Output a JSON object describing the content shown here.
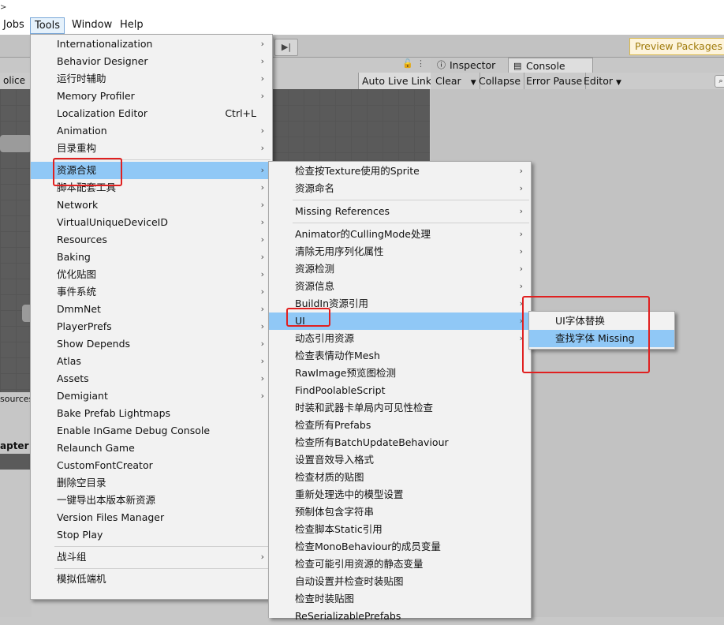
{
  "menubar": {
    "tiny": ">",
    "items": [
      "Jobs",
      "Tools",
      "Window",
      "Help"
    ]
  },
  "toolbar": {
    "step_icon": "step-forward-icon",
    "step_glyph": "▶|",
    "preview_packages": "Preview Packages in"
  },
  "scene": {
    "tab_fragment": "olice",
    "lock_icon": "lock-icon",
    "more_icon": "more-menu-icon",
    "auto_live_link": "Auto Live Link",
    "resources_fragment": "sourcesF",
    "chapter_fragment": "apter"
  },
  "console": {
    "tabs": [
      {
        "label": "Inspector",
        "icon": "info-icon"
      },
      {
        "label": "Console",
        "icon": "console-icon"
      }
    ],
    "toolbar": [
      "Clear",
      "Collapse",
      "Error Pause",
      "Editor"
    ]
  },
  "tools_menu": {
    "items": [
      {
        "label": "Internationalization",
        "arrow": true
      },
      {
        "label": "Behavior Designer",
        "arrow": true
      },
      {
        "label": "运行时辅助",
        "arrow": true
      },
      {
        "label": "Memory Profiler",
        "arrow": true
      },
      {
        "label": "Localization Editor",
        "shortcut": "Ctrl+L"
      },
      {
        "label": "Animation",
        "arrow": true
      },
      {
        "label": "目录重构",
        "arrow": true
      },
      {
        "label": "资源合规",
        "arrow": true,
        "highlighted": true
      },
      {
        "label": "脚本配套工具",
        "arrow": true
      },
      {
        "label": "Network",
        "arrow": true
      },
      {
        "label": "VirtualUniqueDeviceID",
        "arrow": true
      },
      {
        "label": "Resources",
        "arrow": true
      },
      {
        "label": "Baking",
        "arrow": true
      },
      {
        "label": "优化贴图",
        "arrow": true
      },
      {
        "label": "事件系统",
        "arrow": true
      },
      {
        "label": "DmmNet",
        "arrow": true
      },
      {
        "label": "PlayerPrefs",
        "arrow": true
      },
      {
        "label": "Show Depends",
        "arrow": true
      },
      {
        "label": "Atlas",
        "arrow": true
      },
      {
        "label": "Assets",
        "arrow": true
      },
      {
        "label": "Demigiant",
        "arrow": true
      },
      {
        "label": "Bake Prefab Lightmaps"
      },
      {
        "label": "Enable InGame Debug Console"
      },
      {
        "label": "Relaunch Game"
      },
      {
        "label": "CustomFontCreator"
      },
      {
        "label": "删除空目录"
      },
      {
        "label": "一键导出本版本新资源"
      },
      {
        "label": "Version Files Manager"
      },
      {
        "label": "Stop Play"
      },
      {
        "label": "战斗组",
        "arrow": true
      },
      {
        "label": "模拟低端机"
      }
    ]
  },
  "compliance_menu": {
    "items": [
      {
        "label": "检查按Texture使用的Sprite",
        "arrow": true
      },
      {
        "label": "资源命名",
        "arrow": true
      },
      {
        "label": "Missing References",
        "arrow": true
      },
      {
        "label": "Animator的CullingMode处理",
        "arrow": true
      },
      {
        "label": "清除无用序列化属性",
        "arrow": true
      },
      {
        "label": "资源检测",
        "arrow": true
      },
      {
        "label": "资源信息",
        "arrow": true
      },
      {
        "label": "BuildIn资源引用",
        "arrow": true
      },
      {
        "label": "UI",
        "arrow": true,
        "highlighted": true
      },
      {
        "label": "动态引用资源",
        "arrow": true
      },
      {
        "label": "检查表情动作Mesh"
      },
      {
        "label": "RawImage预览图检测"
      },
      {
        "label": "FindPoolableScript"
      },
      {
        "label": "时装和武器卡单局内可见性检查"
      },
      {
        "label": "检查所有Prefabs"
      },
      {
        "label": "检查所有BatchUpdateBehaviour"
      },
      {
        "label": "设置音效导入格式"
      },
      {
        "label": "检查材质的贴图"
      },
      {
        "label": "重新处理选中的模型设置"
      },
      {
        "label": "预制体包含字符串"
      },
      {
        "label": "检查脚本Static引用"
      },
      {
        "label": "检查MonoBehaviour的成员变量"
      },
      {
        "label": "检查可能引用资源的静态变量"
      },
      {
        "label": "自动设置并检查时装贴图"
      },
      {
        "label": "检查时装贴图"
      },
      {
        "label": "ReSerializablePrefabs"
      }
    ]
  },
  "ui_menu": {
    "items": [
      {
        "label": "UI字体替换"
      },
      {
        "label": "查找字体 Missing",
        "highlighted": true
      }
    ]
  },
  "colors": {
    "highlight": "#90c8f6",
    "annotation": "#e02020",
    "preview_bg": "#fdf4dc",
    "preview_text": "#a07b0b"
  }
}
